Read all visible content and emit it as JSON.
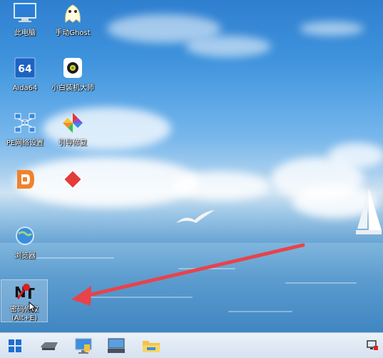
{
  "desktop_icons": [
    {
      "label": "此电脑",
      "icon": "computer-icon"
    },
    {
      "label": "手动Ghost",
      "icon": "ghost-icon"
    },
    {
      "label": "Aida64",
      "icon": "aida64-icon"
    },
    {
      "label": "小白装机大师",
      "icon": "installer-icon"
    },
    {
      "label": "PE网络设置",
      "icon": "network-icon"
    },
    {
      "label": "引导修复",
      "icon": "pinwheel-icon"
    },
    {
      "label": "",
      "icon": "app-d-icon"
    },
    {
      "label": "",
      "icon": "red-diamond-icon"
    },
    {
      "label": "浏览器",
      "icon": "browser-globe-icon"
    },
    {
      "label": "密码修改\n(Alt+E)",
      "icon": "password-tool-icon"
    }
  ],
  "taskbar": {
    "buttons": [
      "windows-start-icon",
      "drive-icon",
      "monitor-icon",
      "keyboard-icon",
      "folder-icon"
    ],
    "tray": [
      "network-tray-icon"
    ]
  },
  "colors": {
    "arrow": "#e8434a",
    "taskbar": "#dbe6f2"
  }
}
